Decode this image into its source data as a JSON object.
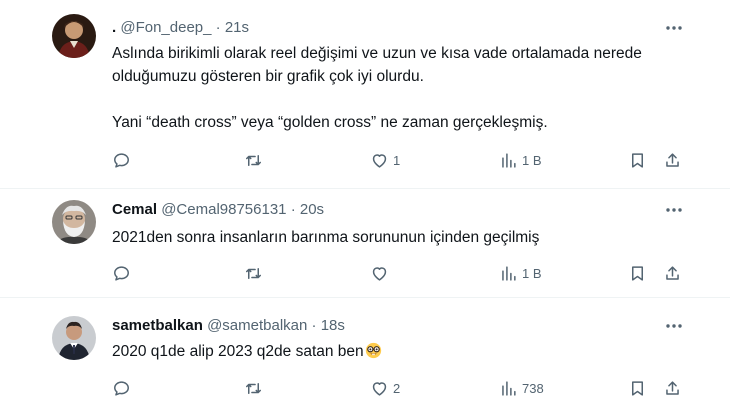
{
  "tweets": [
    {
      "name": ".",
      "handle": "@Fon_deep_",
      "separator": "·",
      "time": "21s",
      "text": [
        "Aslında birikimli olarak reel değişimi ve uzun ve kısa vade ortalamada nerede olduğumuzu gösteren bir grafik çok iyi olurdu.",
        "Yani “death cross” veya “golden cross” ne zaman gerçekleşmiş."
      ],
      "avatar_icon": "portrait-avatar",
      "stats": {
        "replies": "",
        "retweets": "",
        "likes": "1",
        "views": "1 B"
      }
    },
    {
      "name": "Cemal",
      "handle": "@Cemal98756131",
      "separator": "·",
      "time": "20s",
      "text": [
        "2021den sonra insanların barınma sorununun içinden geçilmiş"
      ],
      "avatar_icon": "bearded-man-avatar",
      "stats": {
        "replies": "",
        "retweets": "",
        "likes": "",
        "views": "1 B"
      }
    },
    {
      "name": "sametbalkan",
      "handle": "@sametbalkan",
      "separator": "·",
      "time": "18s",
      "text": [
        "2020 q1de alip 2023 q2de satan ben"
      ],
      "emoji": "nerd-face-emoji",
      "avatar_icon": "suited-man-avatar",
      "stats": {
        "replies": "",
        "retweets": "",
        "likes": "2",
        "views": "738"
      }
    }
  ],
  "colors": {
    "text": "#0f1419",
    "muted": "#536471",
    "divider": "#eff3f4"
  },
  "icons": [
    "more-icon",
    "reply-icon",
    "retweet-icon",
    "like-icon",
    "views-icon",
    "bookmark-icon",
    "share-icon"
  ]
}
